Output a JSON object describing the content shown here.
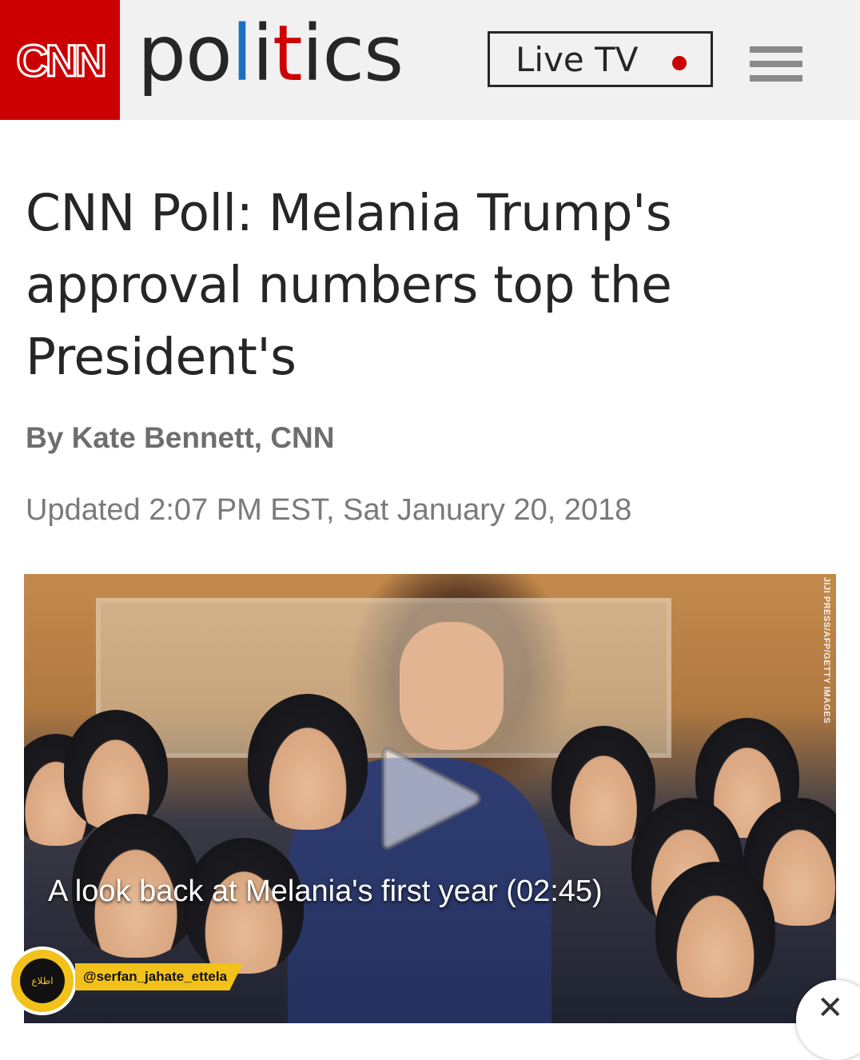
{
  "header": {
    "logo_text": "CNN",
    "section_title": {
      "p1": "po",
      "p2": "l",
      "p3": "i",
      "p4": "t",
      "p5": "ics"
    },
    "live_tv_label": "Live TV",
    "colors": {
      "brand_red": "#cc0000",
      "accent_blue": "#1a6fbf",
      "header_bg": "#f1f1f1"
    }
  },
  "article": {
    "headline": "CNN Poll: Melania Trump's approval numbers top the President's",
    "byline": "By Kate Bennett, CNN",
    "updated": "Updated 2:07 PM EST, Sat January 20, 2018"
  },
  "video": {
    "caption": "A look back at Melania's first year (02:45)",
    "photo_credit": "JIJI PRESS/AFP/GETTY IMAGES",
    "play_icon": "play-icon"
  },
  "watermark": {
    "badge_text": "اطلاع",
    "handle": "@serfan_jahate_ettela"
  },
  "icons": {
    "menu": "hamburger-menu-icon",
    "live_dot": "live-indicator-icon",
    "close": "close-icon"
  }
}
